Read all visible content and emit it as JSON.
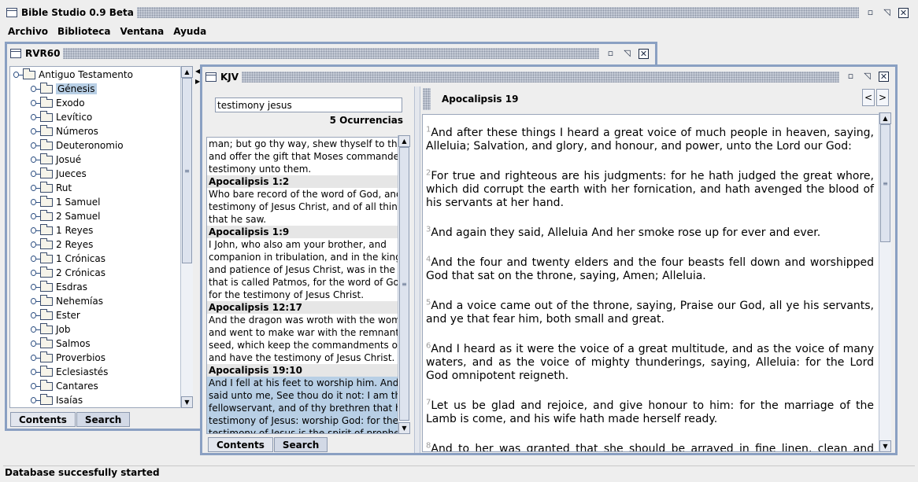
{
  "app": {
    "title": "Bible Studio 0.9 Beta"
  },
  "menu": [
    "Archivo",
    "Biblioteca",
    "Ventana",
    "Ayuda"
  ],
  "left_window": {
    "title": "RVR60",
    "tree_root": "Antiguo Testamento",
    "books": [
      "Génesis",
      "Exodo",
      "Levítico",
      "Números",
      "Deuteronomio",
      "Josué",
      "Jueces",
      "Rut",
      "1 Samuel",
      "2 Samuel",
      "1 Reyes",
      "2 Reyes",
      "1 Crónicas",
      "2 Crónicas",
      "Esdras",
      "Nehemías",
      "Ester",
      "Job",
      "Salmos",
      "Proverbios",
      "Eclesiastés",
      "Cantares",
      "Isaías"
    ],
    "selected_book": "Génesis",
    "tabs": [
      "Contents",
      "Search"
    ]
  },
  "right_window": {
    "title": "KJV",
    "search": {
      "value": "testimony jesus",
      "count": "5 Ocurrencias"
    },
    "results": [
      {
        "ref": "",
        "text": [
          "man; but go thy way, shew thyself to the pries",
          "and offer the gift that Moses commanded, for",
          "testimony unto them."
        ]
      },
      {
        "ref": "Apocalipsis 1:2",
        "text": [
          "Who bare record of the word of God, and of th",
          "testimony of Jesus Christ, and of all things",
          "that he saw."
        ]
      },
      {
        "ref": "Apocalipsis 1:9",
        "text": [
          "I John, who also am your brother, and",
          "companion in tribulation, and in the kingdom",
          "and patience of Jesus Christ, was in the isle",
          "that is called Patmos, for the word of God, an",
          "for the testimony of Jesus Christ."
        ]
      },
      {
        "ref": "Apocalipsis 12:17",
        "text": [
          "And the dragon was wroth with the woman,",
          "and went to make war with the remnant of he",
          "seed, which keep the commandments of God,",
          "and have the testimony of Jesus Christ."
        ]
      },
      {
        "ref": "Apocalipsis 19:10",
        "text": [
          "And I fell at his feet to worship him. And he",
          "said unto me, See thou do it not: I am thy",
          "fellowservant, and of thy brethren that have th",
          "testimony of Jesus: worship God: for the",
          "testimony of Jesus is the spirit of prophecy."
        ],
        "selected": true
      }
    ],
    "tabs": [
      "Contents",
      "Search"
    ],
    "chapter_title": "Apocalipsis 19",
    "nav": {
      "prev": "<",
      "next": ">"
    },
    "verses": [
      {
        "n": "1",
        "text": "And after these things I heard a great voice of much people in heaven, saying, Alleluia; Salvation, and glory, and honour, and power, unto the Lord our God:"
      },
      {
        "n": "2",
        "text": "For true and righteous are his judgments: for he hath judged the great whore, which did corrupt the earth with her fornication, and hath avenged the blood of his servants at her hand."
      },
      {
        "n": "3",
        "text": "And again they said, Alleluia And her smoke rose up for ever and ever."
      },
      {
        "n": "4",
        "text": "And the four and twenty elders and the four beasts fell down and worshipped God that sat on the throne, saying, Amen; Alleluia."
      },
      {
        "n": "5",
        "text": "And a voice came out of the throne, saying, Praise our God, all ye his servants, and ye that fear him, both small and great."
      },
      {
        "n": "6",
        "text": "And I heard as it were the voice of a great multitude, and as the voice of many waters, and as the voice of mighty thunderings, saying, Alleluia: for the Lord God omnipotent reigneth."
      },
      {
        "n": "7",
        "text": "Let us be glad and rejoice, and give honour to him: for the marriage of the Lamb is come, and his wife hath made herself ready."
      },
      {
        "n": "8",
        "text": "And to her was granted that she should be arrayed in fine linen, clean and white: for the fine linen is the righteousness of saints."
      }
    ]
  },
  "status": "Database succesfully started"
}
